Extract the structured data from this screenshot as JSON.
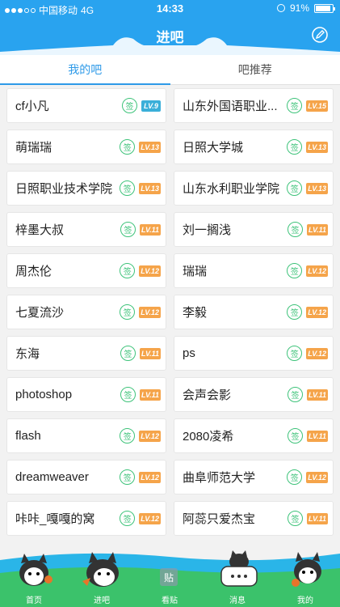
{
  "status_bar": {
    "carrier": "中国移动",
    "network": "4G",
    "time": "14:33",
    "battery": "91%"
  },
  "header": {
    "title": "进吧"
  },
  "tabs": [
    {
      "label": "我的吧",
      "active": true
    },
    {
      "label": "吧推荐",
      "active": false
    }
  ],
  "sign_icon_text": "签",
  "forums": [
    {
      "name": "cf小凡",
      "level": "LV.9",
      "color": "blue"
    },
    {
      "name": "山东外国语职业...",
      "level": "LV.15",
      "color": "orange"
    },
    {
      "name": "萌瑞瑞",
      "level": "LV.13",
      "color": "orange"
    },
    {
      "name": "日照大学城",
      "level": "LV.13",
      "color": "orange"
    },
    {
      "name": "日照职业技术学院",
      "level": "LV.13",
      "color": "orange"
    },
    {
      "name": "山东水利职业学院",
      "level": "LV.13",
      "color": "orange"
    },
    {
      "name": "梓墨大叔",
      "level": "LV.11",
      "color": "orange"
    },
    {
      "name": "刘一搁浅",
      "level": "LV.11",
      "color": "orange"
    },
    {
      "name": "周杰伦",
      "level": "LV.12",
      "color": "orange"
    },
    {
      "name": "瑞瑞",
      "level": "LV.12",
      "color": "orange"
    },
    {
      "name": "七夏流沙",
      "level": "LV.12",
      "color": "orange"
    },
    {
      "name": "李毅",
      "level": "LV.12",
      "color": "orange"
    },
    {
      "name": "东海",
      "level": "LV.11",
      "color": "orange"
    },
    {
      "name": "ps",
      "level": "LV.12",
      "color": "orange"
    },
    {
      "name": "photoshop",
      "level": "LV.11",
      "color": "orange"
    },
    {
      "name": "会声会影",
      "level": "LV.11",
      "color": "orange"
    },
    {
      "name": "flash",
      "level": "LV.12",
      "color": "orange"
    },
    {
      "name": "2080凌希",
      "level": "LV.11",
      "color": "orange"
    },
    {
      "name": "dreamweaver",
      "level": "LV.12",
      "color": "orange"
    },
    {
      "name": "曲阜师范大学",
      "level": "LV.12",
      "color": "orange"
    },
    {
      "name": "咔咔_嘎嘎的窝",
      "level": "LV.12",
      "color": "orange"
    },
    {
      "name": "阿蕊只爱杰宝",
      "level": "LV.11",
      "color": "orange"
    }
  ],
  "bottom_nav": [
    {
      "label": "首页",
      "active": false
    },
    {
      "label": "进吧",
      "active": true
    },
    {
      "label": "看贴",
      "active": false
    },
    {
      "label": "消息",
      "active": false
    },
    {
      "label": "我的",
      "active": false
    }
  ],
  "colors": {
    "header": "#29a3ef",
    "accent": "#2e9ae8",
    "sign": "#3ec37a",
    "level": "#f5a44a",
    "level_blue": "#3aafd9"
  }
}
